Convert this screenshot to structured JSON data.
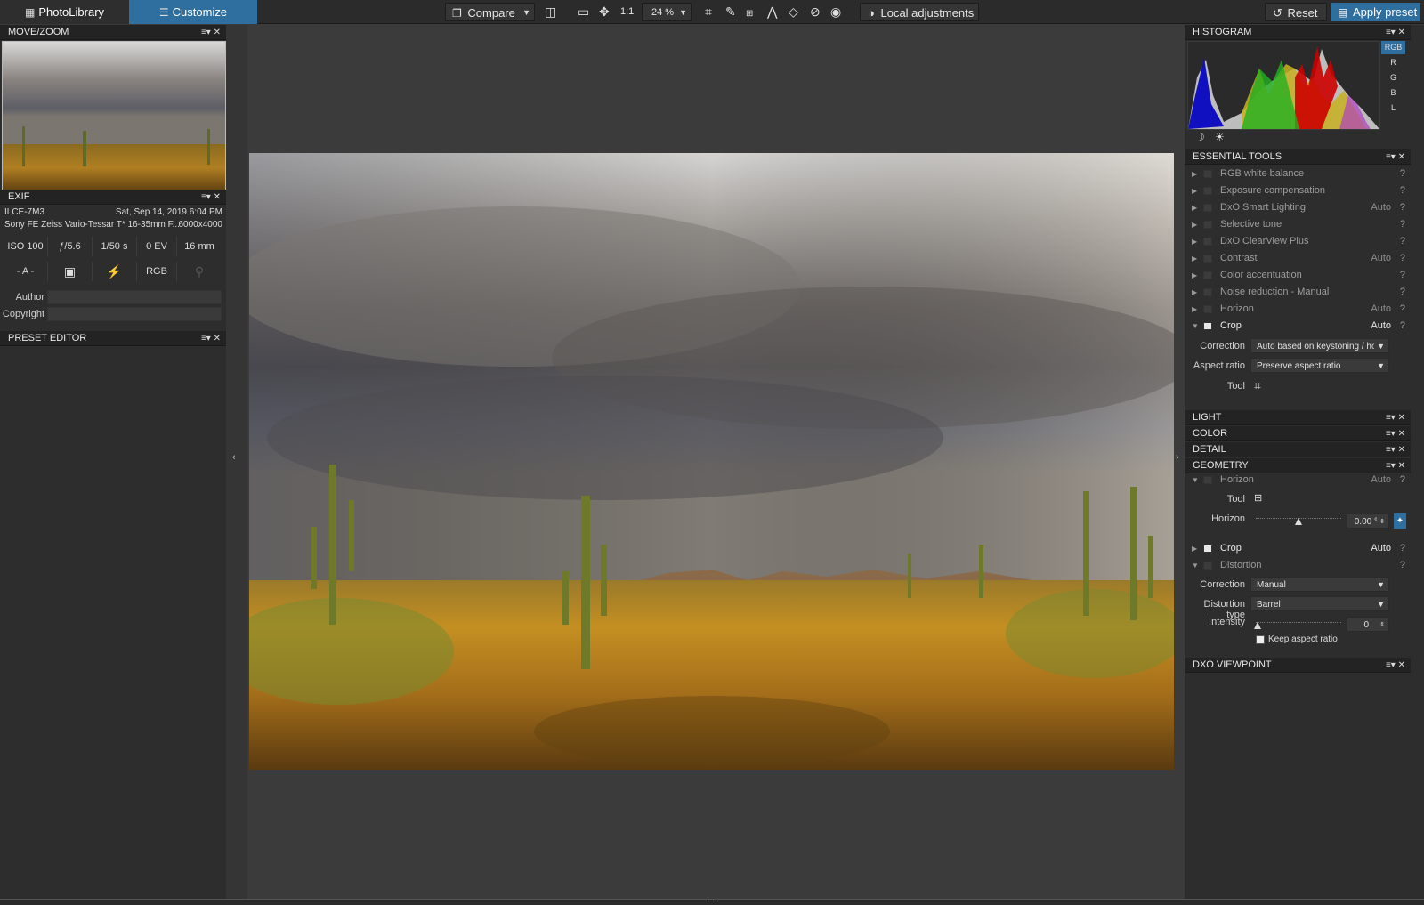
{
  "topbar": {
    "tab_photolibrary": "PhotoLibrary",
    "tab_customize": "Customize",
    "compare": "Compare",
    "one_to_one": "1:1",
    "zoom": "24 %",
    "local_adjustments": "Local adjustments",
    "reset": "Reset",
    "apply_preset": "Apply preset"
  },
  "left": {
    "movezoom_title": "MOVE/ZOOM",
    "exif_title": "EXIF",
    "camera": "ILCE-7M3",
    "date": "Sat, Sep 14, 2019 6:04 PM",
    "lens": "Sony FE Zeiss Vario-Tessar T* 16-35mm F...",
    "dimensions": "6000x4000",
    "iso": "ISO 100",
    "aperture": "ƒ/5.6",
    "shutter": "1/50 s",
    "ev": "0 EV",
    "focal": "16 mm",
    "mode": "- A -",
    "colorspace": "RGB",
    "author_label": "Author",
    "copyright_label": "Copyright",
    "preset_editor_title": "PRESET EDITOR"
  },
  "right": {
    "histogram_title": "HISTOGRAM",
    "hist_channels": [
      "RGB",
      "R",
      "G",
      "B",
      "L"
    ],
    "essential_title": "ESSENTIAL TOOLS",
    "essential_items": [
      {
        "label": "RGB white balance",
        "auto": "",
        "q": "?"
      },
      {
        "label": "Exposure compensation",
        "auto": "",
        "q": "?"
      },
      {
        "label": "DxO Smart Lighting",
        "auto": "Auto",
        "q": "?"
      },
      {
        "label": "Selective tone",
        "auto": "",
        "q": "?"
      },
      {
        "label": "DxO ClearView Plus",
        "auto": "",
        "q": "?"
      },
      {
        "label": "Contrast",
        "auto": "Auto",
        "q": "?"
      },
      {
        "label": "Color accentuation",
        "auto": "",
        "q": "?"
      },
      {
        "label": "Noise reduction - Manual",
        "auto": "",
        "q": "?"
      },
      {
        "label": "Horizon",
        "auto": "Auto",
        "q": "?"
      },
      {
        "label": "Crop",
        "auto": "Auto",
        "q": "?"
      }
    ],
    "crop_correction_label": "Correction",
    "crop_correction_value": "Auto based on keystoning / ho",
    "crop_aspect_label": "Aspect ratio",
    "crop_aspect_value": "Preserve aspect ratio",
    "crop_tool_label": "Tool",
    "light_title": "LIGHT",
    "color_title": "COLOR",
    "detail_title": "DETAIL",
    "geometry_title": "GEOMETRY",
    "geo_horizon": {
      "label": "Horizon",
      "auto": "Auto",
      "q": "?"
    },
    "geo_tool_label": "Tool",
    "geo_horizon_label": "Horizon",
    "geo_horizon_value": "0.00 °",
    "geo_crop": {
      "label": "Crop",
      "auto": "Auto",
      "q": "?"
    },
    "geo_distortion": {
      "label": "Distortion",
      "auto": "",
      "q": "?"
    },
    "dist_correction_label": "Correction",
    "dist_correction_value": "Manual",
    "dist_type_label": "Distortion type",
    "dist_type_value": "Barrel",
    "dist_intensity_label": "Intensity",
    "dist_intensity_value": "0",
    "keep_aspect_label": "Keep aspect ratio",
    "viewpoint_title": "DXO VIEWPOINT"
  }
}
